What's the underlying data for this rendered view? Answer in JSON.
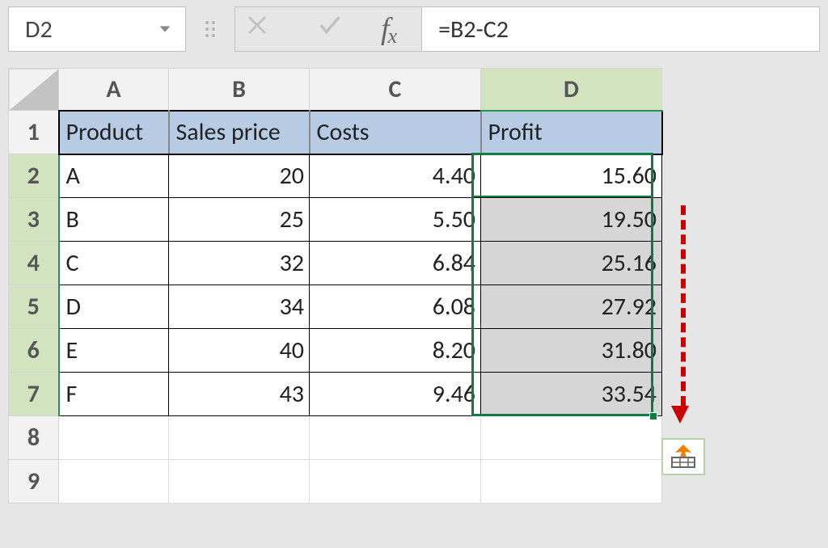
{
  "namebox": {
    "value": "D2"
  },
  "formula": {
    "value": "=B2-C2"
  },
  "columns": [
    "A",
    "B",
    "C",
    "D"
  ],
  "rows": [
    "1",
    "2",
    "3",
    "4",
    "5",
    "6",
    "7",
    "8",
    "9"
  ],
  "headers": {
    "A": "Product",
    "B": "Sales price",
    "C": "Costs",
    "D": "Profit"
  },
  "data": [
    {
      "product": "A",
      "sales": "20",
      "costs": "4.40",
      "profit": "15.60"
    },
    {
      "product": "B",
      "sales": "25",
      "costs": "5.50",
      "profit": "19.50"
    },
    {
      "product": "C",
      "sales": "32",
      "costs": "6.84",
      "profit": "25.16"
    },
    {
      "product": "D",
      "sales": "34",
      "costs": "6.08",
      "profit": "27.92"
    },
    {
      "product": "E",
      "sales": "40",
      "costs": "8.20",
      "profit": "31.80"
    },
    {
      "product": "F",
      "sales": "43",
      "costs": "9.46",
      "profit": "33.54"
    }
  ],
  "icons": {
    "fx_f": "f",
    "fx_x": "x"
  }
}
